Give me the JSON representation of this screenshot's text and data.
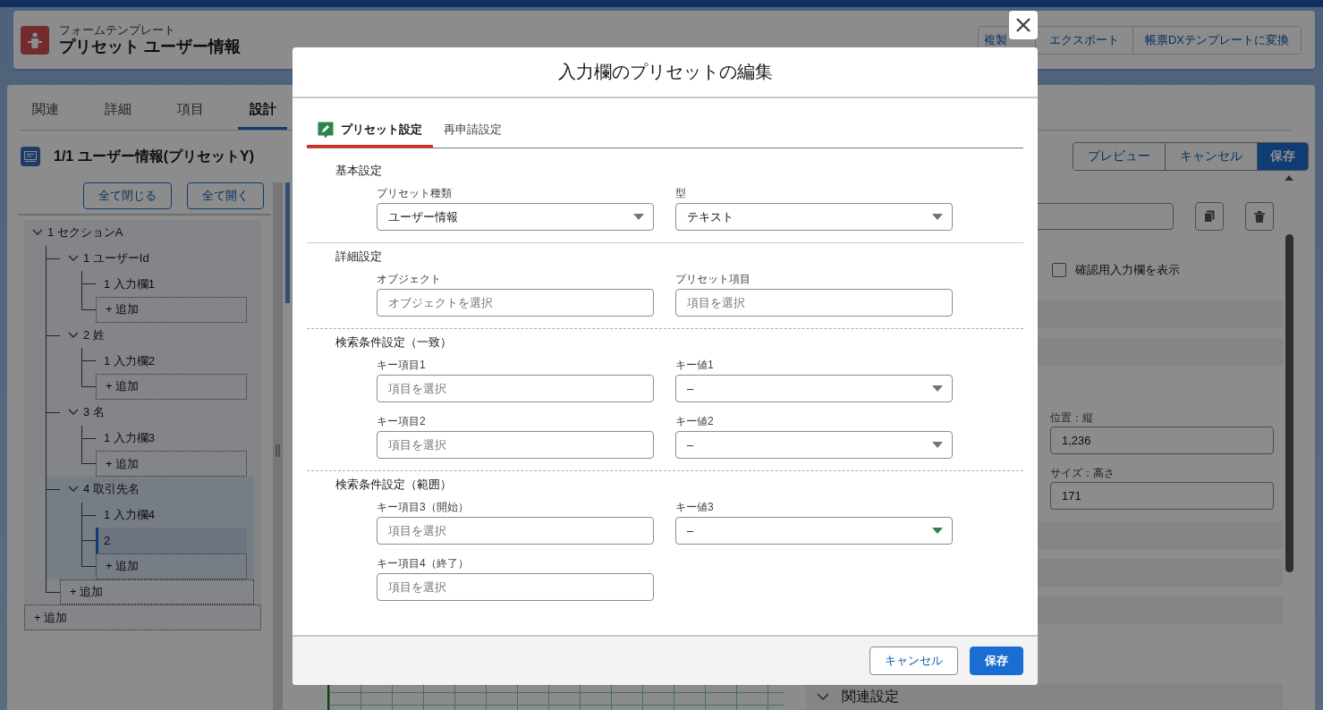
{
  "header": {
    "subtitle": "フォームテンプレート",
    "title": "プリセット ユーザー情報",
    "buttons": [
      "複製",
      "エクスポート",
      "帳票DXテンプレートに変換"
    ]
  },
  "tabs": [
    {
      "label": "関連",
      "selected": false
    },
    {
      "label": "詳細",
      "selected": false
    },
    {
      "label": "項目",
      "selected": false
    },
    {
      "label": "設計",
      "selected": true
    }
  ],
  "page_title": "1/1 ユーザー情報(プリセットY)",
  "actions": [
    {
      "label": "プレビュー",
      "kind": "neutral"
    },
    {
      "label": "キャンセル",
      "kind": "neutral"
    },
    {
      "label": "保存",
      "kind": "brand"
    }
  ],
  "tree": {
    "buttons": [
      "全て閉じる",
      "全て開く"
    ],
    "nodes": [
      {
        "kind": "node",
        "label": "1 セクションA",
        "expanded": true,
        "selected": false,
        "highlighted": false,
        "children": [
          {
            "kind": "node",
            "label": "1 ユーザーId",
            "expanded": true,
            "selected": false,
            "highlighted": false,
            "children": [
              {
                "kind": "node",
                "label": "1 入力欄1",
                "selected": false,
                "highlighted": false
              },
              {
                "kind": "add",
                "label": "+ 追加"
              }
            ]
          },
          {
            "kind": "node",
            "label": "2 姓",
            "expanded": true,
            "selected": false,
            "highlighted": false,
            "children": [
              {
                "kind": "node",
                "label": "1 入力欄2",
                "selected": false,
                "highlighted": false
              },
              {
                "kind": "add",
                "label": "+ 追加"
              }
            ]
          },
          {
            "kind": "node",
            "label": "3 名",
            "expanded": true,
            "selected": false,
            "highlighted": false,
            "children": [
              {
                "kind": "node",
                "label": "1 入力欄3",
                "selected": false,
                "highlighted": false
              },
              {
                "kind": "add",
                "label": "+ 追加"
              }
            ]
          },
          {
            "kind": "node",
            "label": "4 取引先名",
            "expanded": true,
            "selected": false,
            "highlighted": true,
            "children": [
              {
                "kind": "node",
                "label": "1 入力欄4",
                "selected": false,
                "highlighted": false
              },
              {
                "kind": "node",
                "label": "2",
                "selected": true,
                "highlighted": false
              },
              {
                "kind": "add",
                "label": "+ 追加"
              }
            ]
          },
          {
            "kind": "add",
            "label": "+ 追加"
          }
        ]
      },
      {
        "kind": "add",
        "label": "+ 追加"
      }
    ]
  },
  "properties": {
    "checkbox": {
      "label": "確認用入力欄を表示",
      "checked": false
    },
    "fields": [
      {
        "label": "位置：縦",
        "value": "1,236"
      },
      {
        "label": "サイズ：高さ",
        "value": "171"
      }
    ],
    "section": {
      "label": "関連設定",
      "expanded": true
    }
  },
  "modal": {
    "title": "入力欄のプリセットの編集",
    "tabs": [
      {
        "label": "プリセット設定",
        "selected": true,
        "kind": "icon"
      },
      {
        "label": "再申請設定",
        "selected": false,
        "kind": "text"
      }
    ],
    "sections": [
      {
        "title": "基本設定",
        "kind": "plain",
        "fields": [
          {
            "label": "プリセット種類",
            "kind": "select",
            "value": "ユーザー情報",
            "color": "#747474"
          },
          {
            "label": "型",
            "kind": "select",
            "value": "テキスト",
            "color": "#747474"
          }
        ]
      },
      {
        "title": "詳細設定",
        "kind": "solid",
        "fields": [
          {
            "label": "オブジェクト",
            "kind": "lookup",
            "placeholder": "オブジェクトを選択"
          },
          {
            "label": "プリセット項目",
            "kind": "lookup",
            "placeholder": "項目を選択"
          }
        ]
      },
      {
        "title": "検索条件設定（一致）",
        "kind": "dashed",
        "fields": [
          {
            "label": "キー項目1",
            "kind": "lookup",
            "placeholder": "項目を選択"
          },
          {
            "label": "キー値1",
            "kind": "select",
            "value": "–",
            "color": "#747474"
          },
          {
            "label": "キー項目2",
            "kind": "lookup",
            "placeholder": "項目を選択"
          },
          {
            "label": "キー値2",
            "kind": "select",
            "value": "–",
            "color": "#747474"
          }
        ]
      },
      {
        "title": "検索条件設定（範囲）",
        "kind": "dashed",
        "fields": [
          {
            "label": "キー項目3（開始）",
            "kind": "lookup",
            "placeholder": "項目を選択"
          },
          {
            "label": "キー値3",
            "kind": "select",
            "value": "–",
            "color": "#2e844a"
          },
          {
            "label": "キー項目4（終了）",
            "kind": "lookup",
            "placeholder": "項目を選択"
          }
        ]
      }
    ],
    "footer_buttons": [
      {
        "label": "キャンセル",
        "kind": "neutral"
      },
      {
        "label": "保存",
        "kind": "brand"
      }
    ]
  }
}
